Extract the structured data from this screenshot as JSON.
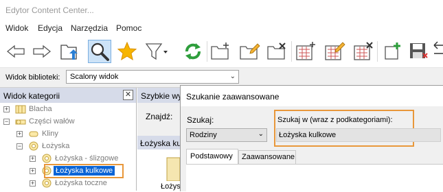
{
  "window": {
    "title": "Edytor Content Center..."
  },
  "menu": [
    "Widok",
    "Edycja",
    "Narzędzia",
    "Pomoc"
  ],
  "toolbar": {
    "buttons": [
      "back-icon",
      "forward-icon",
      "folder-up-icon",
      "search-icon",
      "favorites-star-icon",
      "filter-icon",
      "refresh-icon",
      "new-category-icon",
      "edit-category-icon",
      "delete-category-icon",
      "new-family-icon",
      "edit-family-icon",
      "delete-family-icon",
      "add-icon",
      "save-icon",
      "rename-icon"
    ]
  },
  "library_bar": {
    "label": "Widok biblioteki:",
    "value": "Scalony widok"
  },
  "left_panel": {
    "title": "Widok kategorii",
    "tree": [
      {
        "label": "Blacha",
        "level": 0,
        "expander": "+"
      },
      {
        "label": "Części wałów",
        "level": 0,
        "expander": "-"
      },
      {
        "label": "Kliny",
        "level": 1,
        "expander": "+"
      },
      {
        "label": "Łożyska",
        "level": 1,
        "expander": "-"
      },
      {
        "label": "Łożyska - ślizgowe",
        "level": 2,
        "expander": "+"
      },
      {
        "label": "Łożyska kulkowe",
        "level": 2,
        "expander": "+",
        "selected": true
      },
      {
        "label": "Łożyska toczne",
        "level": 2,
        "expander": "+"
      }
    ]
  },
  "mid_panel": {
    "quick_search": "Szybkie wy",
    "find_label": "Znajdź:",
    "result_header": "Łożyska ku",
    "item_label": "Łożys"
  },
  "dialog": {
    "title": "Szukanie zaawansowane",
    "search_label": "Szukaj:",
    "search_value": "Rodziny",
    "search_in_label": "Szukaj w (wraz z podkategoriami):",
    "search_in_value": "Łożyska kulkowe",
    "tabs": [
      "Podstawowy",
      "Zaawansowane"
    ],
    "highlight_color": "#e8973a"
  }
}
